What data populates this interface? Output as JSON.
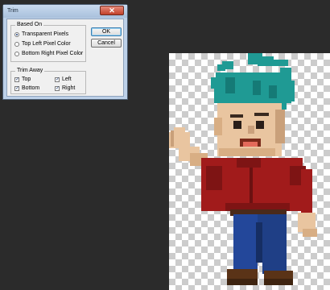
{
  "dialog": {
    "title": "Trim",
    "close_icon": "close-icon",
    "based_on": {
      "legend": "Based On",
      "options": [
        {
          "label": "Transparent Pixels",
          "selected": true
        },
        {
          "label": "Top Left Pixel Color",
          "selected": false
        },
        {
          "label": "Bottom Right Pixel Color",
          "selected": false
        }
      ]
    },
    "trim_away": {
      "legend": "Trim Away",
      "top": {
        "label": "Top",
        "checked": true
      },
      "left": {
        "label": "Left",
        "checked": true
      },
      "bottom": {
        "label": "Bottom",
        "checked": true
      },
      "right": {
        "label": "Right",
        "checked": true
      }
    },
    "ok_label": "OK",
    "cancel_label": "Cancel"
  },
  "colors": {
    "workspace": "#2b2b2b",
    "hair": "#1f9a94",
    "shirt": "#a11b1b",
    "pants": "#1f3f86",
    "skin": "#e9c5a0"
  }
}
